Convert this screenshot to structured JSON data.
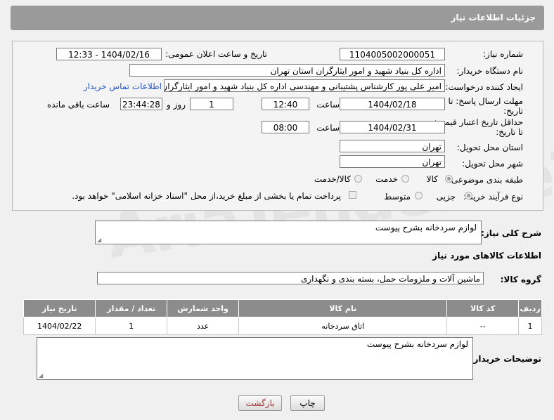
{
  "header": {
    "title": "جزئیات اطلاعات نیاز"
  },
  "form": {
    "need_number_label": "شماره نیاز:",
    "need_number": "1104005002000051",
    "announce_label": "تاریخ و ساعت اعلان عمومی:",
    "announce_value": "1404/02/16 - 12:33",
    "buyer_org_label": "نام دستگاه خریدار:",
    "buyer_org": "اداره کل بنیاد شهید و امور ایثارگران استان تهران",
    "creator_label": "ایجاد کننده درخواست:",
    "creator": "امیر علی پور کارشناس پشتیبانی و مهندسی اداره کل بنیاد شهید و امور ایثارگران",
    "contact_link": "اطلاعات تماس خریدار",
    "deadline_label_1": "مهلت ارسال پاسخ: تا",
    "deadline_label_2": "تاریخ:",
    "deadline_date": "1404/02/18",
    "time_label": "ساعت",
    "deadline_time": "12:40",
    "days_value": "1",
    "days_label": "روز و",
    "remaining_time": "23:44:28",
    "remaining_label": "ساعت باقی مانده",
    "min_validity_label_1": "حداقل تاریخ اعتبار قیمت:",
    "min_validity_label_2": "تا تاریخ:",
    "validity_date": "1404/02/31",
    "validity_time_label": "ساعت",
    "validity_time": "08:00",
    "province_label": "استان محل تحویل:",
    "province": "تهران",
    "city_label": "شهر محل تحویل:",
    "city": "تهران",
    "category_label": "طبقه بندی موضوعی:",
    "category_options": [
      "کالا",
      "خدمت",
      "کالا/خدمت"
    ],
    "process_label": "نوع فرآیند خرید :",
    "process_options": [
      "جزیی",
      "متوسط"
    ],
    "payment_note": "پرداخت تمام یا بخشی از مبلغ خرید،از محل \"اسناد خزانه اسلامی\" خواهد بود."
  },
  "summary": {
    "label": "شرح کلی نیاز:",
    "text": "لوازم سردخانه بشرح پیوست"
  },
  "goods_section_title": "اطلاعات کالاهای مورد نیاز",
  "goods_group": {
    "label": "گروه کالا:",
    "value": "ماشین آلات و ملزومات حمل، بسته بندی و نگهداری"
  },
  "table": {
    "headers": [
      "ردیف",
      "کد کالا",
      "نام کالا",
      "واحد شمارش",
      "تعداد / مقدار",
      "تاریخ نیاز"
    ],
    "rows": [
      [
        "1",
        "--",
        "اتاق سردخانه",
        "عدد",
        "1",
        "1404/02/22"
      ]
    ]
  },
  "buyer_notes": {
    "label": "توضیحات خریدار:",
    "text": "لوازم سردخانه بشرح پیوست"
  },
  "buttons": {
    "print": "چاپ",
    "back": "بازگشت"
  },
  "watermark": "AriaTender.neT"
}
